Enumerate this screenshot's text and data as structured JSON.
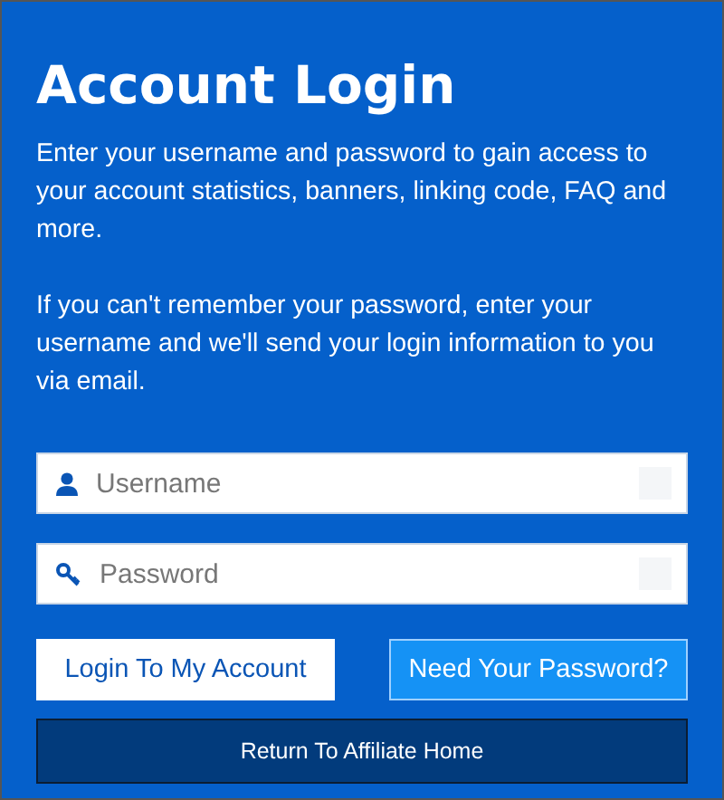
{
  "title": "Account Login",
  "paragraphs": [
    "Enter your username and password to gain access to your account statistics, banners, linking code, FAQ and more.",
    "If you can't remember your password, enter your username and we'll send your login information to you via email."
  ],
  "fields": [
    {
      "kind": "user",
      "placeholder": "Username"
    },
    {
      "kind": "key",
      "placeholder": "Password"
    }
  ],
  "buttons": [
    {
      "kind": "primary",
      "label": "Login To My Account"
    },
    {
      "kind": "secondary",
      "label": "Need Your Password?"
    }
  ],
  "return_button": {
    "label": "Return To Affiliate Home"
  }
}
